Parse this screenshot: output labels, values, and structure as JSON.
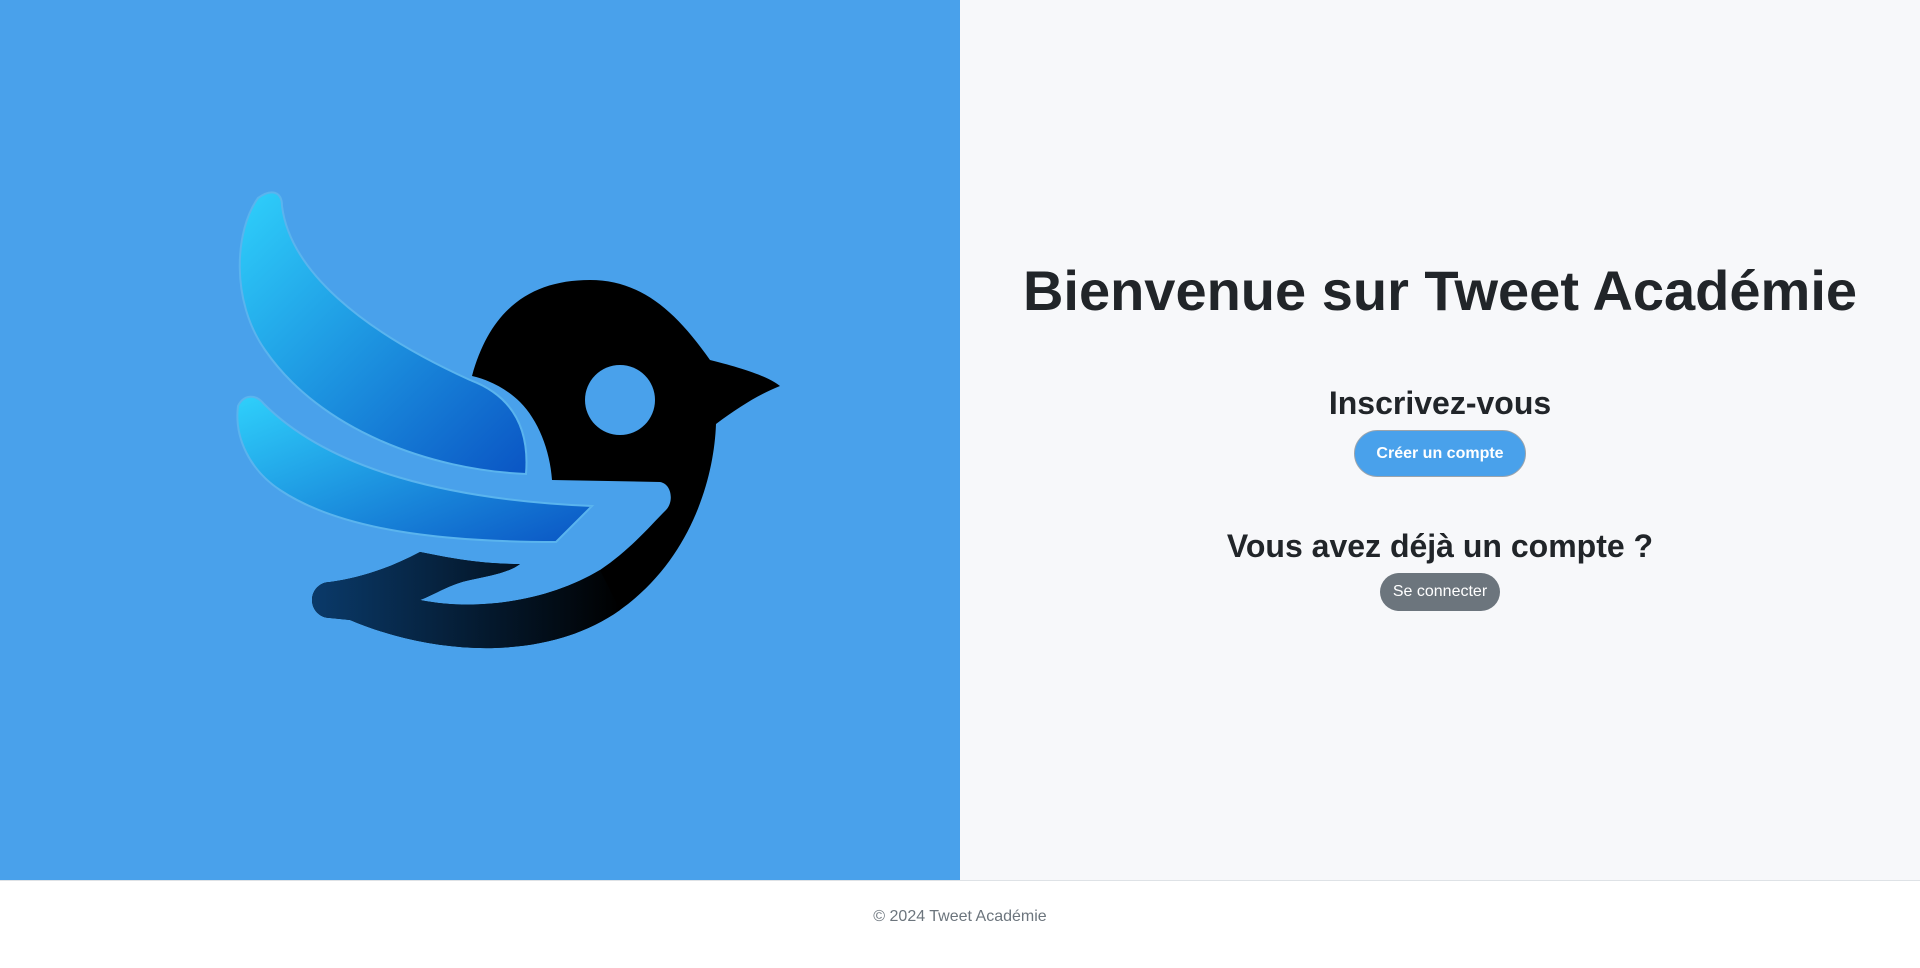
{
  "left_panel": {
    "background": "#49a1eb",
    "logo_icon": "bird-logo-icon"
  },
  "right_panel": {
    "title": "Bienvenue sur Tweet Académie",
    "signup": {
      "heading": "Inscrivez-vous",
      "button_label": "Créer un compte"
    },
    "login": {
      "heading": "Vous avez déjà un compte ?",
      "button_label": "Se connecter"
    }
  },
  "footer": {
    "text": "© 2024 Tweet Académie"
  },
  "colors": {
    "accent": "#49a1eb",
    "secondary_button": "#6c757d",
    "text": "#212529",
    "panel_background": "#f7f8fa"
  }
}
